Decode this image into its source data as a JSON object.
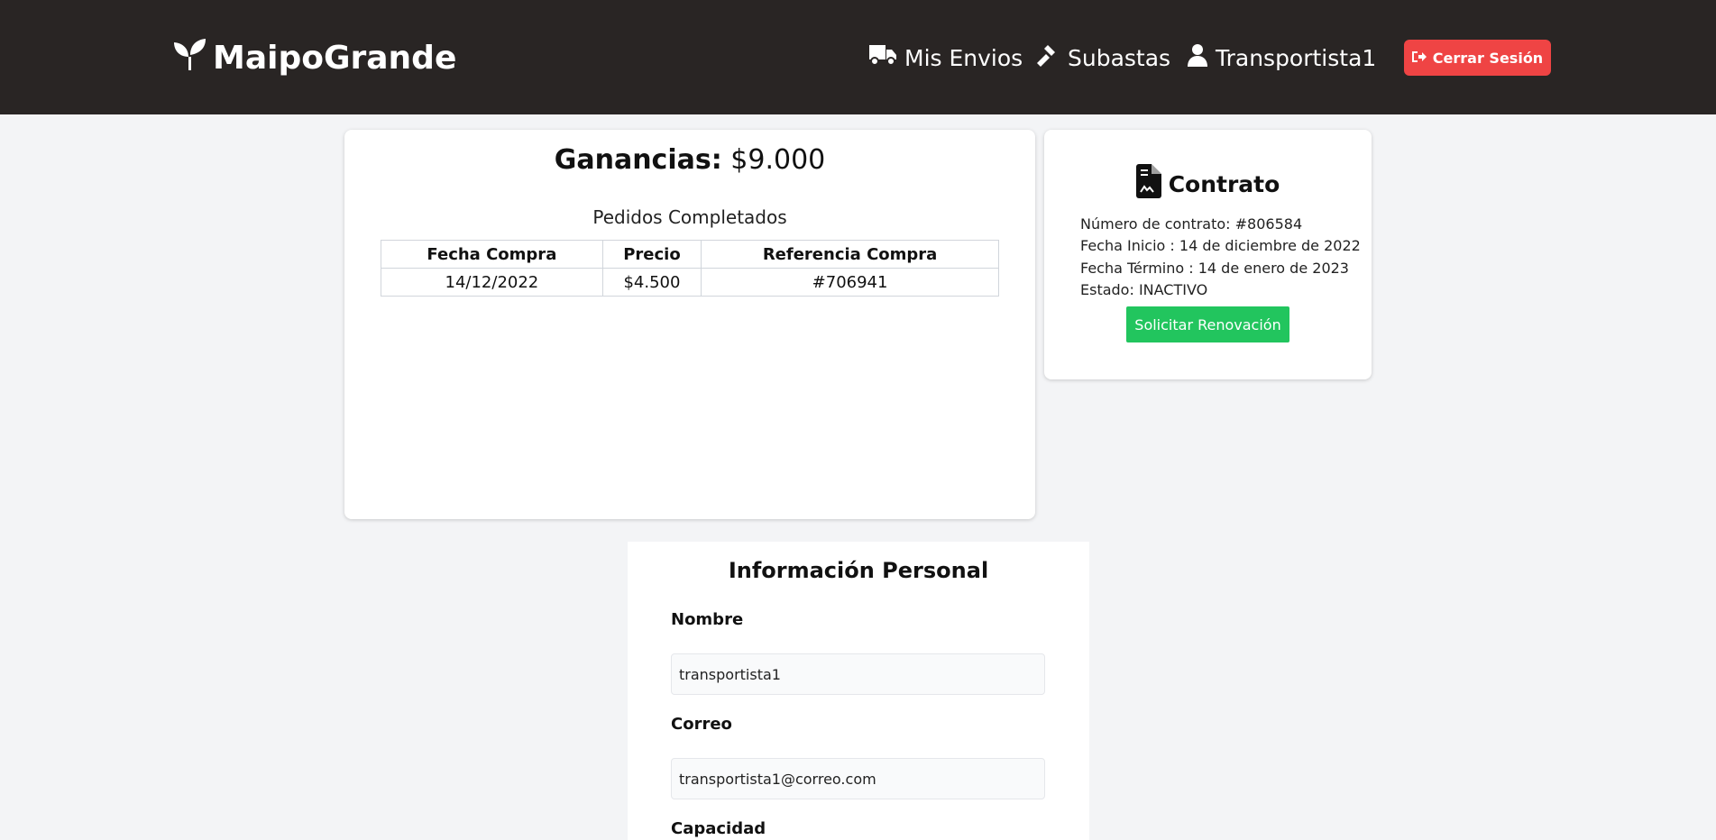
{
  "nav": {
    "brand": "MaipoGrande",
    "links": [
      {
        "label": "Mis Envios",
        "icon": "truck-icon"
      },
      {
        "label": "Subastas",
        "icon": "gavel-icon"
      },
      {
        "label": "Transportista1",
        "icon": "user-icon"
      }
    ],
    "logout_label": "Cerrar Sesión",
    "colors": {
      "navbar": "#292524",
      "logout": "#ef4444"
    }
  },
  "earnings": {
    "title_label": "Ganancias:",
    "title_value": "$9.000",
    "subtitle": "Pedidos Completados",
    "columns": [
      "Fecha Compra",
      "Precio",
      "Referencia Compra"
    ],
    "rows": [
      [
        "14/12/2022",
        "$4.500",
        "#706941"
      ]
    ]
  },
  "contract": {
    "title": "Contrato",
    "icon": "file-contract-icon",
    "lines": [
      "Número de contrato: #806584",
      "Fecha Inicio : 14 de diciembre de 2022",
      "Fecha Término : 14 de enero de 2023",
      "Estado: INACTIVO"
    ],
    "renew_label": "Solicitar Renovación",
    "renew_color": "#22c55e"
  },
  "personal": {
    "title": "Información Personal",
    "fields": [
      {
        "label": "Nombre",
        "value": "transportista1"
      },
      {
        "label": "Correo",
        "value": "transportista1@correo.com"
      },
      {
        "label": "Capacidad",
        "value": ""
      }
    ]
  }
}
